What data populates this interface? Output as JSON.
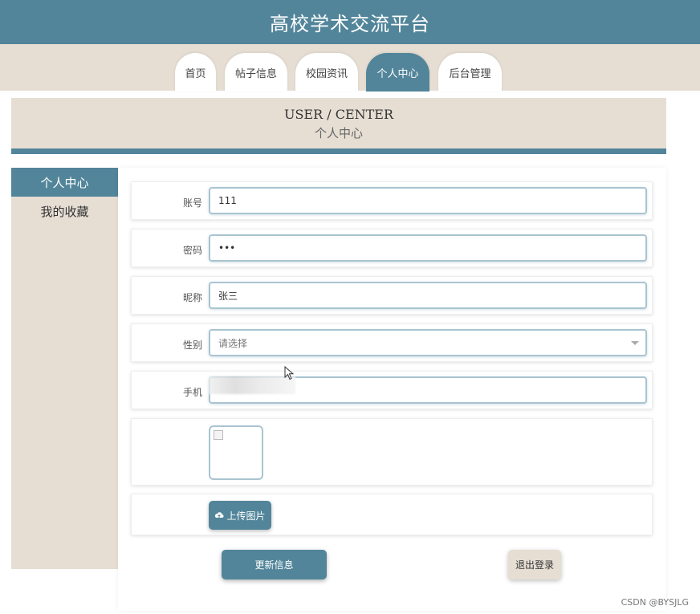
{
  "header": {
    "title": "高校学术交流平台"
  },
  "nav": {
    "tabs": [
      {
        "label": "首页"
      },
      {
        "label": "帖子信息"
      },
      {
        "label": "校园资讯"
      },
      {
        "label": "个人中心"
      },
      {
        "label": "后台管理"
      }
    ],
    "active_index": 3
  },
  "banner": {
    "en": "USER / CENTER",
    "cn": "个人中心"
  },
  "sidebar": {
    "items": [
      {
        "label": "个人中心"
      },
      {
        "label": "我的收藏"
      }
    ],
    "active_index": 0
  },
  "form": {
    "account": {
      "label": "账号",
      "value": "111"
    },
    "password": {
      "label": "密码",
      "value": "•••"
    },
    "nickname": {
      "label": "昵称",
      "value": "张三"
    },
    "gender": {
      "label": "性别",
      "placeholder": "请选择"
    },
    "phone": {
      "label": "手机",
      "value": ""
    },
    "avatar": {
      "upload_label": "上传图片"
    }
  },
  "actions": {
    "update_label": "更新信息",
    "logout_label": "退出登录"
  },
  "watermark": "CSDN @BYSJLG",
  "colors": {
    "primary": "#52859a",
    "beige": "#e6ded3",
    "field_border": "#a9c4d1"
  }
}
